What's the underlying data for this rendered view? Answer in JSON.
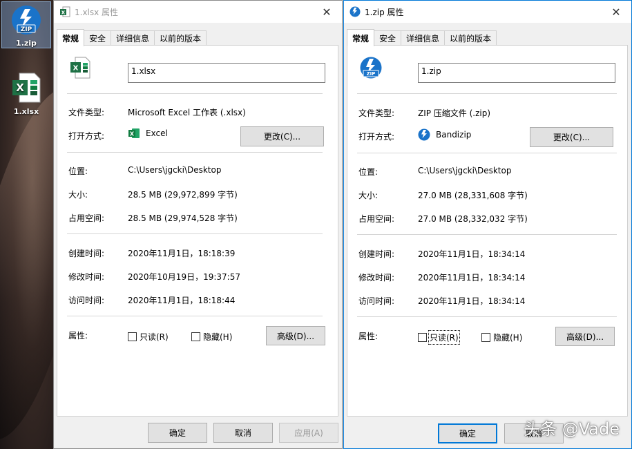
{
  "desktop": {
    "icons": [
      {
        "label": "1.zip",
        "badge": "ZIP",
        "icon": "bandizip-zip-icon"
      },
      {
        "label": "1.xlsx",
        "icon": "excel-file-icon"
      }
    ]
  },
  "colors": {
    "excel_green": "#1e7145",
    "bandizip_blue": "#1a73c9",
    "focus_blue": "#0078d7"
  },
  "dialog_left": {
    "title": "1.xlsx 属性",
    "close": "✕",
    "tabs": [
      "常规",
      "安全",
      "详细信息",
      "以前的版本"
    ],
    "filename": "1.xlsx",
    "file_type_label": "文件类型:",
    "file_type_value": "Microsoft Excel 工作表 (.xlsx)",
    "open_with_label": "打开方式:",
    "open_with_value": "Excel",
    "change_button": "更改(C)...",
    "location_label": "位置:",
    "location_value": "C:\\Users\\jgcki\\Desktop",
    "size_label": "大小:",
    "size_value": "28.5 MB (29,972,899 字节)",
    "disk_size_label": "占用空间:",
    "disk_size_value": "28.5 MB (29,974,528 字节)",
    "created_label": "创建时间:",
    "created_value": "2020年11月1日，18:18:39",
    "modified_label": "修改时间:",
    "modified_value": "2020年10月19日，19:37:57",
    "accessed_label": "访问时间:",
    "accessed_value": "2020年11月1日，18:18:44",
    "attributes_label": "属性:",
    "readonly_label": "只读(R)",
    "hidden_label": "隐藏(H)",
    "advanced_button": "高级(D)...",
    "ok_button": "确定",
    "cancel_button": "取消",
    "apply_button": "应用(A)"
  },
  "dialog_right": {
    "title": "1.zip 属性",
    "close": "✕",
    "tabs": [
      "常规",
      "安全",
      "详细信息",
      "以前的版本"
    ],
    "filename": "1.zip",
    "file_type_label": "文件类型:",
    "file_type_value": "ZIP 压缩文件 (.zip)",
    "open_with_label": "打开方式:",
    "open_with_value": "Bandizip",
    "change_button": "更改(C)...",
    "location_label": "位置:",
    "location_value": "C:\\Users\\jgcki\\Desktop",
    "size_label": "大小:",
    "size_value": "27.0 MB (28,331,608 字节)",
    "disk_size_label": "占用空间:",
    "disk_size_value": "27.0 MB (28,332,032 字节)",
    "created_label": "创建时间:",
    "created_value": "2020年11月1日，18:34:14",
    "modified_label": "修改时间:",
    "modified_value": "2020年11月1日，18:34:14",
    "accessed_label": "访问时间:",
    "accessed_value": "2020年11月1日，18:34:14",
    "attributes_label": "属性:",
    "readonly_label": "只读(R)",
    "hidden_label": "隐藏(H)",
    "advanced_button": "高级(D)...",
    "ok_button": "确定",
    "cancel_button": "取消"
  },
  "watermark": "头条 @Vade"
}
